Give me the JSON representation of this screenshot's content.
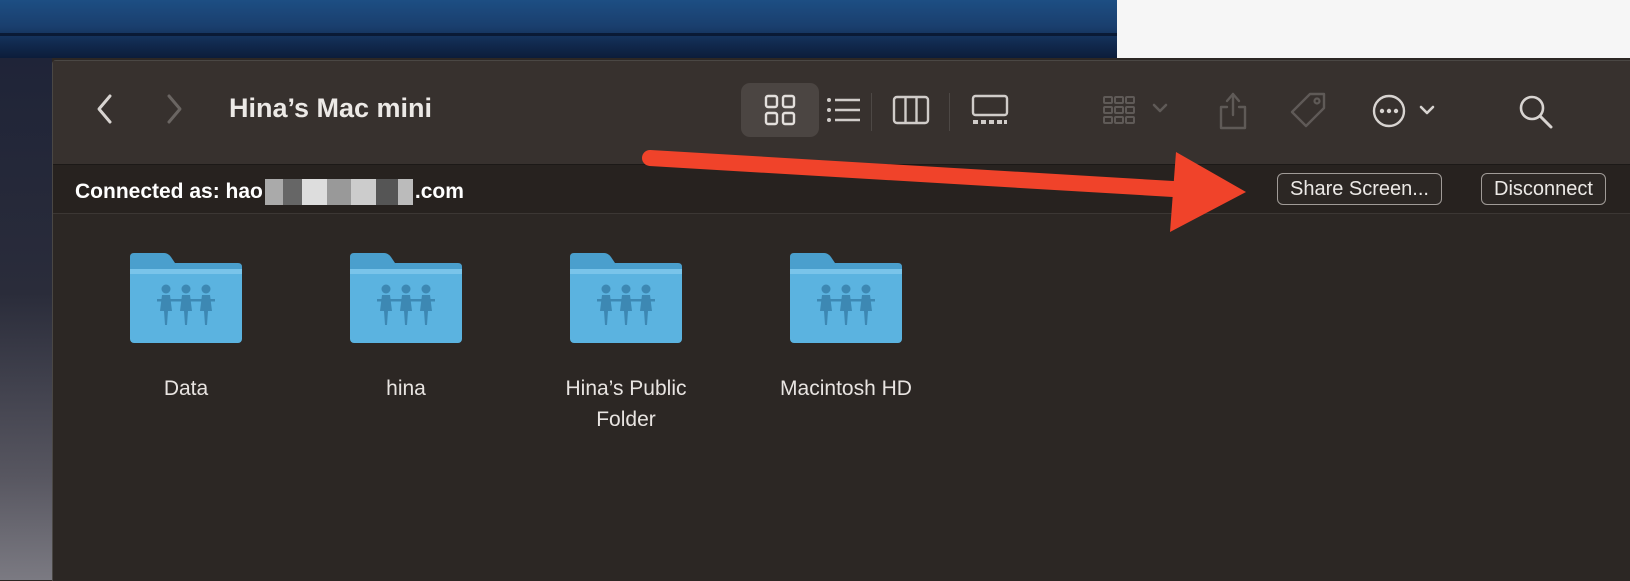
{
  "window": {
    "title": "Hina’s Mac mini"
  },
  "toolbar": {
    "back_icon": "chevron-left-icon",
    "forward_icon": "chevron-right-icon",
    "views": [
      "icon-view",
      "list-view",
      "column-view",
      "gallery-view"
    ],
    "selected_view": "icon-view",
    "group_icon": "group-by-icon",
    "share_icon": "share-icon",
    "tag_icon": "tag-icon",
    "more_icon": "more-actions-icon",
    "search_icon": "search-icon"
  },
  "connection": {
    "label": "Connected as: hao",
    "suffix": ".com",
    "share_screen_label": "Share Screen...",
    "disconnect_label": "Disconnect"
  },
  "items": [
    {
      "label": "Data",
      "icon": "shared-folder-icon"
    },
    {
      "label": "hina",
      "icon": "shared-folder-icon"
    },
    {
      "label": "Hina’s Public Folder",
      "icon": "shared-folder-icon"
    },
    {
      "label": "Macintosh HD",
      "icon": "shared-folder-icon"
    }
  ],
  "colors": {
    "toolbar_bg": "#37312e",
    "window_bg": "#2c2724",
    "folder_blue": "#5bb1de",
    "annotation_arrow": "#f0432a"
  }
}
